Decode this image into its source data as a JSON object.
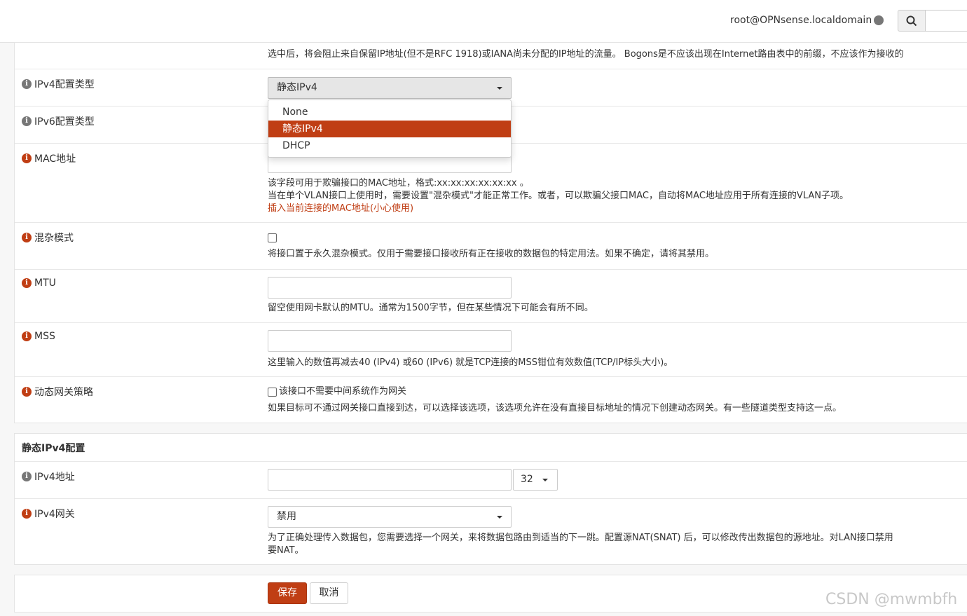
{
  "header": {
    "user": "root@OPNsense.localdomain",
    "search_placeholder": ""
  },
  "top_help": "选中后，将会阻止来自保留IP地址(但不是RFC 1918)或IANA尚未分配的IP地址的流量。 Bogons是不应该出现在Internet路由表中的前缀，不应该作为接收的",
  "ipv4_type": {
    "label": "IPv4配置类型",
    "selected": "静态IPv4",
    "options": [
      "None",
      "静态IPv4",
      "DHCP"
    ]
  },
  "ipv6_type": {
    "label": "IPv6配置类型"
  },
  "mac": {
    "label": "MAC地址",
    "help1": "该字段可用于欺骗接口的MAC地址，格式:xx:xx:xx:xx:xx:xx 。",
    "help2": "当在单个VLAN接口上使用时，需要设置\"混杂模式\"才能正常工作。或者，可以欺骗父接口MAC，自动将MAC地址应用于所有连接的VLAN子项。",
    "insert_link": "插入当前连接的MAC地址(小心使用)"
  },
  "promisc": {
    "label": "混杂模式",
    "help": "将接口置于永久混杂模式。仅用于需要接口接收所有正在接收的数据包的特定用法。如果不确定，请将其禁用。"
  },
  "mtu": {
    "label": "MTU",
    "help": "留空使用网卡默认的MTU。通常为1500字节，但在某些情况下可能会有所不同。"
  },
  "mss": {
    "label": "MSS",
    "help": "这里输入的数值再减去40 (IPv4) 或60 (IPv6) 就是TCP连接的MSS钳位有效数值(TCP/IP标头大小)。"
  },
  "dyn_gw": {
    "label": "动态网关策略",
    "checkbox_label": "该接口不需要中间系统作为网关",
    "help": "如果目标可不通过网关接口直接到达，可以选择该选项，该选项允许在没有直接目标地址的情况下创建动态网关。有一些隧道类型支持这一点。"
  },
  "static_section": {
    "title": "静态IPv4配置",
    "addr_label": "IPv4地址",
    "cidr": "32",
    "gw_label": "IPv4网关",
    "gw_selected": "禁用",
    "gw_help1": "为了正确处理传入数据包，您需要选择一个网关，来将数据包路由到适当的下一跳。配置源NAT(SNAT) 后，可以修改传出数据包的源地址。对LAN接口禁用",
    "gw_help2": "要NAT。"
  },
  "buttons": {
    "save": "保存",
    "cancel": "取消"
  },
  "watermark": "CSDN @mwmbfh"
}
